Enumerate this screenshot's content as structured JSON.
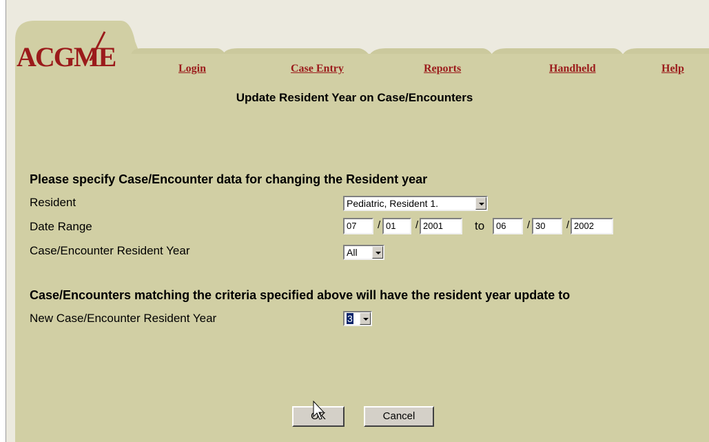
{
  "brand": {
    "logo_text": "ACGME",
    "color": "#9b1b1b"
  },
  "nav": {
    "login": "Login",
    "case_entry": "Case Entry",
    "reports": "Reports",
    "handheld": "Handheld",
    "help": "Help"
  },
  "page_title": "Update Resident Year on Case/Encounters",
  "criteria": {
    "heading": "Please specify Case/Encounter data for changing the Resident year",
    "resident_label": "Resident",
    "resident_value": "Pediatric, Resident 1.",
    "date_range_label": "Date Range",
    "start_month": "07",
    "start_day": "01",
    "start_year": "2001",
    "to_label": "to",
    "end_month": "06",
    "end_day": "30",
    "end_year": "2002",
    "resident_year_label": "Case/Encounter Resident Year",
    "resident_year_value": "All"
  },
  "update": {
    "heading": "Case/Encounters matching the criteria specified above will have the resident year update to",
    "new_year_label": "New Case/Encounter Resident Year",
    "new_year_value": "3"
  },
  "buttons": {
    "ok": "OK",
    "cancel": "Cancel"
  },
  "colors": {
    "panel": "#d1cfa4",
    "tab": "#d1cfa4",
    "link": "#9b1b1b"
  }
}
